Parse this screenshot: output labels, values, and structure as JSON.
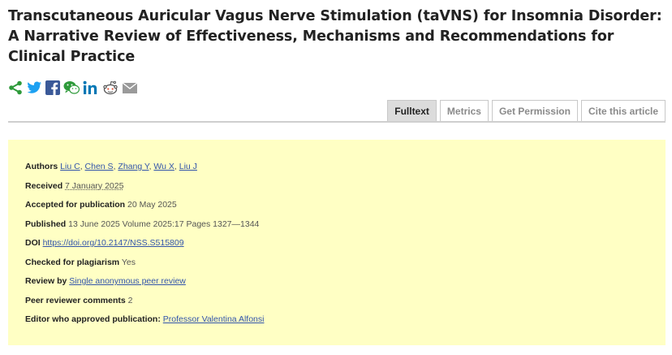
{
  "article": {
    "title": "Transcutaneous Auricular Vagus Nerve Stimulation (taVNS) for Insomnia Disorder: A Narrative Review of Effectiveness, Mechanisms and Recommendations for Clinical Practice"
  },
  "share_icons": [
    "share-icon",
    "twitter-icon",
    "facebook-icon",
    "wechat-icon",
    "linkedin-icon",
    "reddit-icon",
    "email-icon"
  ],
  "tabs": [
    {
      "label": "Fulltext",
      "active": true
    },
    {
      "label": "Metrics",
      "active": false
    },
    {
      "label": "Get Permission",
      "active": false
    },
    {
      "label": "Cite this article",
      "active": false
    }
  ],
  "info": {
    "authors_label": "Authors",
    "authors": [
      "Liu C",
      "Chen S",
      "Zhang Y",
      "Wu X",
      "Liu J"
    ],
    "received_label": "Received",
    "received": "7 January 2025",
    "accepted_label": "Accepted for publication",
    "accepted": "20 May 2025",
    "published_label": "Published",
    "published": "13 June 2025 Volume 2025:17 Pages 1327—1344",
    "doi_label": "DOI",
    "doi": "https://doi.org/10.2147/NSS.S515809",
    "plagiarism_label": "Checked for plagiarism",
    "plagiarism": "Yes",
    "review_label": "Review by",
    "review": "Single anonymous peer review",
    "comments_label": "Peer reviewer comments",
    "comments": "2",
    "editor_label": "Editor who approved publication:",
    "editor": "Professor Valentina Alfonsi"
  },
  "colors": {
    "info_background": "#ffffc4",
    "link": "#3355aa",
    "share_green": "#2e9a3a",
    "twitter_blue": "#1da1f2",
    "facebook_blue": "#3b5998",
    "linkedin_blue": "#0077b5"
  }
}
